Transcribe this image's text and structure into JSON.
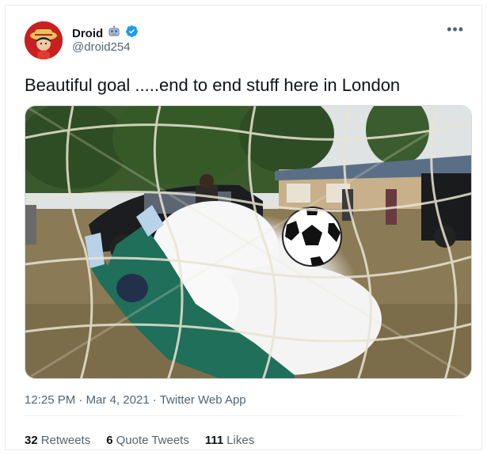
{
  "user": {
    "display_name": "Droid",
    "handle": "@droid254",
    "badge_emoji": "robot-emoji",
    "verified_icon": "verified-badge-icon"
  },
  "tweet": {
    "text": "Beautiful goal .....end to end stuff here in London",
    "time": "12:25 PM",
    "date": "Mar 4, 2021",
    "source": "Twitter Web App",
    "separator": "·"
  },
  "stats": {
    "retweets_count": "32",
    "retweets_label": "Retweets",
    "quote_count": "6",
    "quote_label": "Quote Tweets",
    "likes_count": "111",
    "likes_label": "Likes"
  },
  "more_menu": "•••",
  "colors": {
    "accent": "#1d9bf0",
    "text": "#0f1419",
    "muted": "#536471"
  }
}
